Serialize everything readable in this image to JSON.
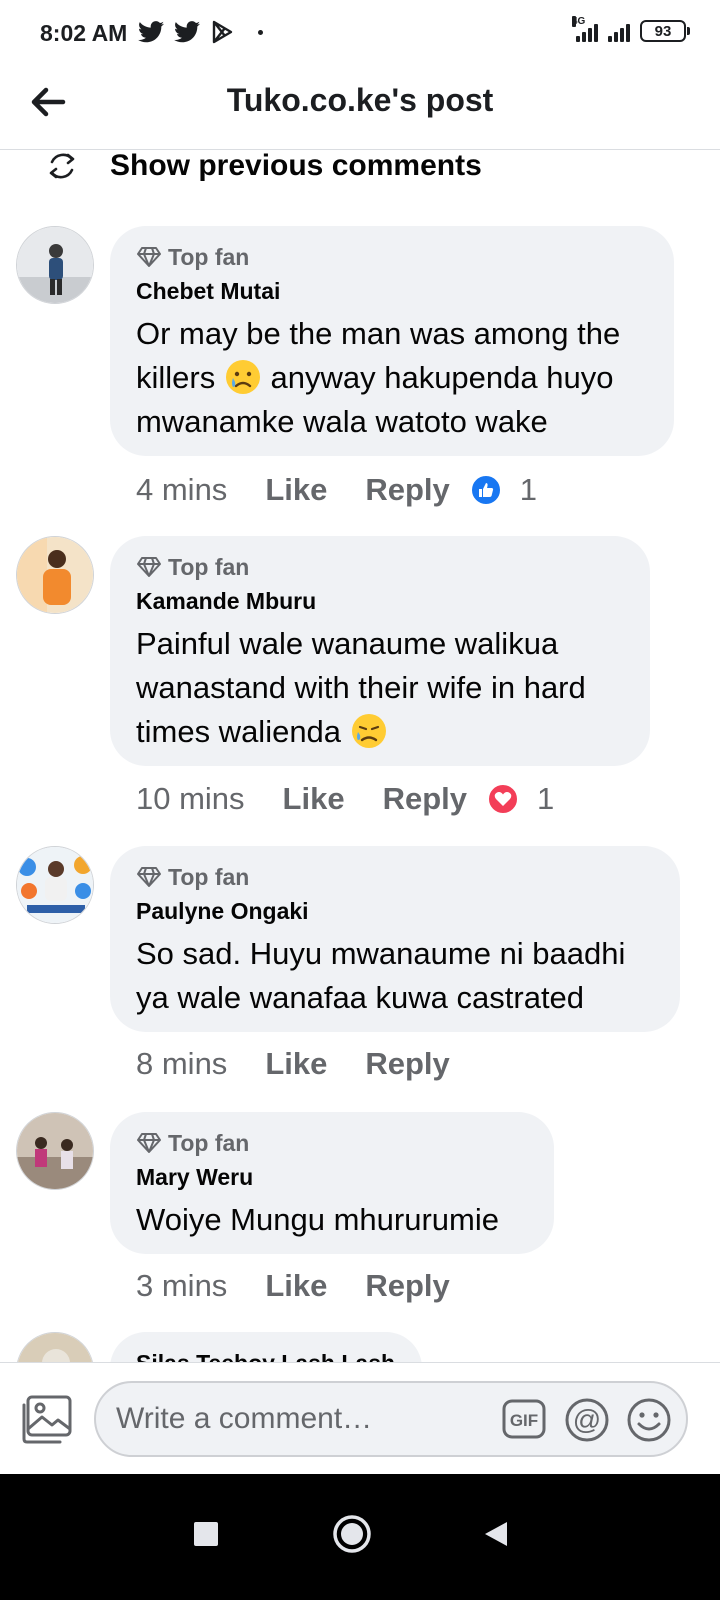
{
  "status_bar": {
    "time": "8:02 AM",
    "network": "4G",
    "battery": "93",
    "left_icons": [
      "twitter-icon",
      "twitter-icon",
      "play-store-icon"
    ]
  },
  "header": {
    "title": "Tuko.co.ke's post",
    "back_icon": "back-arrow-icon"
  },
  "feed": {
    "show_previous": "Show previous comments",
    "comments": [
      {
        "badge": "Top fan",
        "author": "Chebet Mutai",
        "text": "Or may be the man was among the killers",
        "text_after_emoji": "anyway hakupenda huyo mwanamke wala watoto wake",
        "emoji": "sad-tear-emoji",
        "time": "4 mins",
        "like": "Like",
        "reply": "Reply",
        "reaction": "like",
        "reaction_count": "1"
      },
      {
        "badge": "Top fan",
        "author": "Kamande Mburu",
        "text": "Painful wale wanaume walikua wanastand with their wife in hard times walienda",
        "emoji": "sad-sweat-emoji",
        "time": "10 mins",
        "like": "Like",
        "reply": "Reply",
        "reaction": "love",
        "reaction_count": "1"
      },
      {
        "badge": "Top fan",
        "author": "Paulyne Ongaki",
        "text": "So sad. Huyu mwanaume ni baadhi ya wale wanafaa kuwa castrated",
        "time": "8 mins",
        "like": "Like",
        "reply": "Reply"
      },
      {
        "badge": "Top fan",
        "author": "Mary Weru",
        "text": "Woiye Mungu mhururumie",
        "time": "3 mins",
        "like": "Like",
        "reply": "Reply"
      }
    ],
    "partial_author": "Silas Teeboy Lash Lash"
  },
  "composer": {
    "placeholder": "Write a comment…",
    "gif_label": "GIF",
    "mention_label": "@"
  },
  "colors": {
    "bubble": "#f0f2f5",
    "secondary_text": "#65676b",
    "like_blue": "#1877f2",
    "love_red": "#f33e58"
  }
}
